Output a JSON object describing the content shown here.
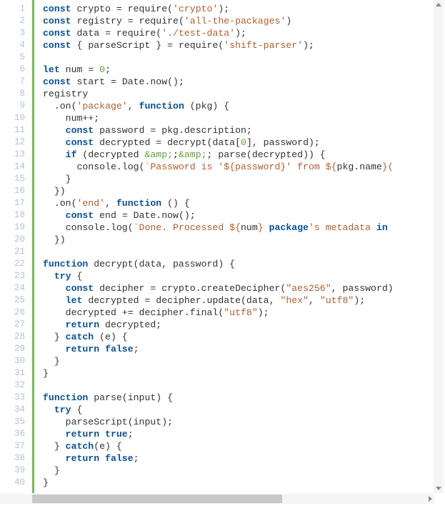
{
  "editor": {
    "language": "javascript",
    "line_count": 40,
    "lines": [
      {
        "n": 1,
        "tokens": [
          [
            "kw",
            "const"
          ],
          [
            "plain",
            " crypto "
          ],
          [
            "punc",
            "="
          ],
          [
            "plain",
            " require("
          ],
          [
            "str",
            "'crypto'"
          ],
          [
            "plain",
            ");"
          ]
        ]
      },
      {
        "n": 2,
        "tokens": [
          [
            "kw",
            "const"
          ],
          [
            "plain",
            " registry "
          ],
          [
            "punc",
            "="
          ],
          [
            "plain",
            " require("
          ],
          [
            "str",
            "'all-the-packages'"
          ],
          [
            "plain",
            ")"
          ]
        ]
      },
      {
        "n": 3,
        "tokens": [
          [
            "kw",
            "const"
          ],
          [
            "plain",
            " data "
          ],
          [
            "punc",
            "="
          ],
          [
            "plain",
            " require("
          ],
          [
            "str",
            "'./test-data'"
          ],
          [
            "plain",
            ");"
          ]
        ]
      },
      {
        "n": 4,
        "tokens": [
          [
            "kw",
            "const"
          ],
          [
            "plain",
            " { parseScript } "
          ],
          [
            "punc",
            "="
          ],
          [
            "plain",
            " require("
          ],
          [
            "str",
            "'shift-parser'"
          ],
          [
            "plain",
            ");"
          ]
        ]
      },
      {
        "n": 5,
        "tokens": [
          [
            "plain",
            ""
          ]
        ]
      },
      {
        "n": 6,
        "tokens": [
          [
            "kw",
            "let"
          ],
          [
            "plain",
            " num "
          ],
          [
            "punc",
            "="
          ],
          [
            "plain",
            " "
          ],
          [
            "num",
            "0"
          ],
          [
            "plain",
            ";"
          ]
        ]
      },
      {
        "n": 7,
        "tokens": [
          [
            "kw",
            "const"
          ],
          [
            "plain",
            " start "
          ],
          [
            "punc",
            "="
          ],
          [
            "plain",
            " Date.now();"
          ]
        ]
      },
      {
        "n": 8,
        "tokens": [
          [
            "plain",
            "registry"
          ]
        ]
      },
      {
        "n": 9,
        "tokens": [
          [
            "plain",
            "  .on("
          ],
          [
            "str",
            "'package'"
          ],
          [
            "plain",
            ", "
          ],
          [
            "kw",
            "function"
          ],
          [
            "plain",
            " (pkg) {"
          ]
        ]
      },
      {
        "n": 10,
        "tokens": [
          [
            "plain",
            "    num++;"
          ]
        ]
      },
      {
        "n": 11,
        "tokens": [
          [
            "plain",
            "    "
          ],
          [
            "kw",
            "const"
          ],
          [
            "plain",
            " password "
          ],
          [
            "punc",
            "="
          ],
          [
            "plain",
            " pkg.description;"
          ]
        ]
      },
      {
        "n": 12,
        "tokens": [
          [
            "plain",
            "    "
          ],
          [
            "kw",
            "const"
          ],
          [
            "plain",
            " decrypted "
          ],
          [
            "punc",
            "="
          ],
          [
            "plain",
            " decrypt(data["
          ],
          [
            "num",
            "0"
          ],
          [
            "plain",
            "], password);"
          ]
        ]
      },
      {
        "n": 13,
        "tokens": [
          [
            "plain",
            "    "
          ],
          [
            "kw",
            "if"
          ],
          [
            "plain",
            " (decrypted "
          ],
          [
            "amp",
            "&amp;"
          ],
          [
            "plain",
            ";"
          ],
          [
            "amp",
            "&amp;"
          ],
          [
            "plain",
            "; parse(decrypted)) {"
          ]
        ]
      },
      {
        "n": 14,
        "tokens": [
          [
            "plain",
            "      console.log("
          ],
          [
            "str",
            "`Password is '"
          ],
          [
            "tmpl",
            "${password}"
          ],
          [
            "str",
            "' from "
          ],
          [
            "tmpl",
            "${"
          ],
          [
            "plain",
            "pkg.name"
          ],
          [
            "tmpl",
            "}"
          ],
          [
            "str",
            "("
          ]
        ]
      },
      {
        "n": 15,
        "tokens": [
          [
            "plain",
            "    }"
          ]
        ]
      },
      {
        "n": 16,
        "tokens": [
          [
            "plain",
            "  })"
          ]
        ]
      },
      {
        "n": 17,
        "tokens": [
          [
            "plain",
            "  .on("
          ],
          [
            "str",
            "'end'"
          ],
          [
            "plain",
            ", "
          ],
          [
            "kw",
            "function"
          ],
          [
            "plain",
            " () {"
          ]
        ]
      },
      {
        "n": 18,
        "tokens": [
          [
            "plain",
            "    "
          ],
          [
            "kw",
            "const"
          ],
          [
            "plain",
            " end "
          ],
          [
            "punc",
            "="
          ],
          [
            "plain",
            " Date.now();"
          ]
        ]
      },
      {
        "n": 19,
        "tokens": [
          [
            "plain",
            "    console.log("
          ],
          [
            "str",
            "`Done. Processed "
          ],
          [
            "tmpl",
            "${"
          ],
          [
            "plain",
            "num"
          ],
          [
            "tmpl",
            "}"
          ],
          [
            "str",
            " "
          ],
          [
            "kw",
            "package"
          ],
          [
            "str",
            "'s metadata "
          ],
          [
            "kw",
            "in"
          ]
        ]
      },
      {
        "n": 20,
        "tokens": [
          [
            "plain",
            "  })"
          ]
        ]
      },
      {
        "n": 21,
        "tokens": [
          [
            "plain",
            ""
          ]
        ]
      },
      {
        "n": 22,
        "tokens": [
          [
            "kw",
            "function"
          ],
          [
            "plain",
            " decrypt(data, password) {"
          ]
        ]
      },
      {
        "n": 23,
        "tokens": [
          [
            "plain",
            "  "
          ],
          [
            "kw",
            "try"
          ],
          [
            "plain",
            " {"
          ]
        ]
      },
      {
        "n": 24,
        "tokens": [
          [
            "plain",
            "    "
          ],
          [
            "kw",
            "const"
          ],
          [
            "plain",
            " decipher "
          ],
          [
            "punc",
            "="
          ],
          [
            "plain",
            " crypto.createDecipher("
          ],
          [
            "str",
            "\"aes256\""
          ],
          [
            "plain",
            ", password)"
          ]
        ]
      },
      {
        "n": 25,
        "tokens": [
          [
            "plain",
            "    "
          ],
          [
            "kw",
            "let"
          ],
          [
            "plain",
            " decrypted "
          ],
          [
            "punc",
            "="
          ],
          [
            "plain",
            " decipher.update(data, "
          ],
          [
            "str",
            "\"hex\""
          ],
          [
            "plain",
            ", "
          ],
          [
            "str",
            "\"utf8\""
          ],
          [
            "plain",
            ");"
          ]
        ]
      },
      {
        "n": 26,
        "tokens": [
          [
            "plain",
            "    decrypted "
          ],
          [
            "punc",
            "+="
          ],
          [
            "plain",
            " decipher.final("
          ],
          [
            "str",
            "\"utf8\""
          ],
          [
            "plain",
            ");"
          ]
        ]
      },
      {
        "n": 27,
        "tokens": [
          [
            "plain",
            "    "
          ],
          [
            "kw",
            "return"
          ],
          [
            "plain",
            " decrypted;"
          ]
        ]
      },
      {
        "n": 28,
        "tokens": [
          [
            "plain",
            "  } "
          ],
          [
            "kw",
            "catch"
          ],
          [
            "plain",
            " (e) {"
          ]
        ]
      },
      {
        "n": 29,
        "tokens": [
          [
            "plain",
            "    "
          ],
          [
            "kw",
            "return"
          ],
          [
            "plain",
            " "
          ],
          [
            "kw",
            "false"
          ],
          [
            "plain",
            ";"
          ]
        ]
      },
      {
        "n": 30,
        "tokens": [
          [
            "plain",
            "  }"
          ]
        ]
      },
      {
        "n": 31,
        "tokens": [
          [
            "plain",
            "}"
          ]
        ]
      },
      {
        "n": 32,
        "tokens": [
          [
            "plain",
            ""
          ]
        ]
      },
      {
        "n": 33,
        "tokens": [
          [
            "kw",
            "function"
          ],
          [
            "plain",
            " parse(input) {"
          ]
        ]
      },
      {
        "n": 34,
        "tokens": [
          [
            "plain",
            "  "
          ],
          [
            "kw",
            "try"
          ],
          [
            "plain",
            " {"
          ]
        ]
      },
      {
        "n": 35,
        "tokens": [
          [
            "plain",
            "    parseScript(input);"
          ]
        ]
      },
      {
        "n": 36,
        "tokens": [
          [
            "plain",
            "    "
          ],
          [
            "kw",
            "return"
          ],
          [
            "plain",
            " "
          ],
          [
            "kw",
            "true"
          ],
          [
            "plain",
            ";"
          ]
        ]
      },
      {
        "n": 37,
        "tokens": [
          [
            "plain",
            "  } "
          ],
          [
            "kw",
            "catch"
          ],
          [
            "plain",
            "(e) {"
          ]
        ]
      },
      {
        "n": 38,
        "tokens": [
          [
            "plain",
            "    "
          ],
          [
            "kw",
            "return"
          ],
          [
            "plain",
            " "
          ],
          [
            "kw",
            "false"
          ],
          [
            "plain",
            ";"
          ]
        ]
      },
      {
        "n": 39,
        "tokens": [
          [
            "plain",
            "  }"
          ]
        ]
      },
      {
        "n": 40,
        "tokens": [
          [
            "plain",
            "}"
          ]
        ]
      }
    ],
    "gutter_color": "#b9c1c9",
    "change_bar_color": "#6fbf4d",
    "token_colors": {
      "kw": "#0451a5",
      "str": "#b75d28",
      "tmpl": "#b75d28",
      "num": "#5ca62e",
      "amp": "#5ca62e",
      "plain": "#333333",
      "punc": "#333333"
    },
    "scroll": {
      "horizontal": {
        "visible": true,
        "thumb_start_frac": 0.07,
        "thumb_width_frac": 0.57
      },
      "vertical": {
        "visible": true
      }
    }
  }
}
